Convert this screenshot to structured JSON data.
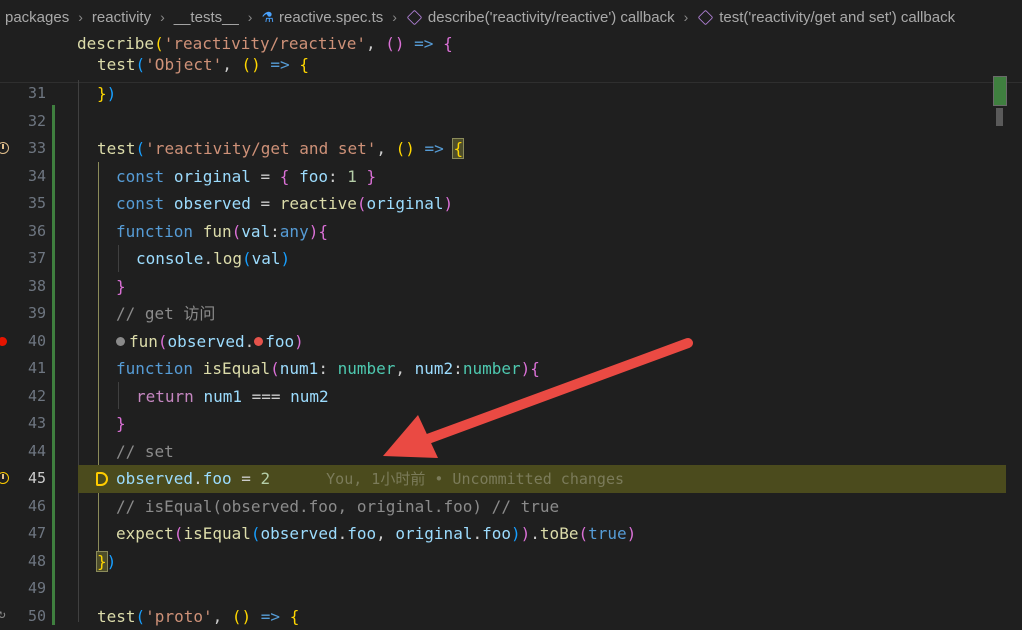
{
  "breadcrumb": {
    "items": [
      {
        "label": "packages",
        "icon": ""
      },
      {
        "label": "reactivity",
        "icon": ""
      },
      {
        "label": "__tests__",
        "icon": ""
      },
      {
        "label": "reactive.spec.ts",
        "icon": "flask-icon"
      },
      {
        "label": "describe('reactivity/reactive') callback",
        "icon": "cube-icon"
      },
      {
        "label": "test('reactivity/get and set') callback",
        "icon": "cube-icon"
      }
    ]
  },
  "sticky": {
    "line1": "describe('reactivity/reactive', () => {",
    "line2": "test('Object', () => {"
  },
  "lines": [
    {
      "num": "31"
    },
    {
      "num": "32"
    },
    {
      "num": "33"
    },
    {
      "num": "34"
    },
    {
      "num": "35"
    },
    {
      "num": "36"
    },
    {
      "num": "37"
    },
    {
      "num": "38"
    },
    {
      "num": "39"
    },
    {
      "num": "40"
    },
    {
      "num": "41"
    },
    {
      "num": "42"
    },
    {
      "num": "43"
    },
    {
      "num": "44"
    },
    {
      "num": "45"
    },
    {
      "num": "46"
    },
    {
      "num": "47"
    },
    {
      "num": "48"
    },
    {
      "num": "49"
    },
    {
      "num": "50"
    }
  ],
  "blame": "You, 1小时前 • Uncommitted changes",
  "colors": {
    "background": "#1f1f1f",
    "current_line": "#4b4b1d",
    "breakpoint": "#e51400",
    "annotation_arrow": "#e8534b"
  }
}
